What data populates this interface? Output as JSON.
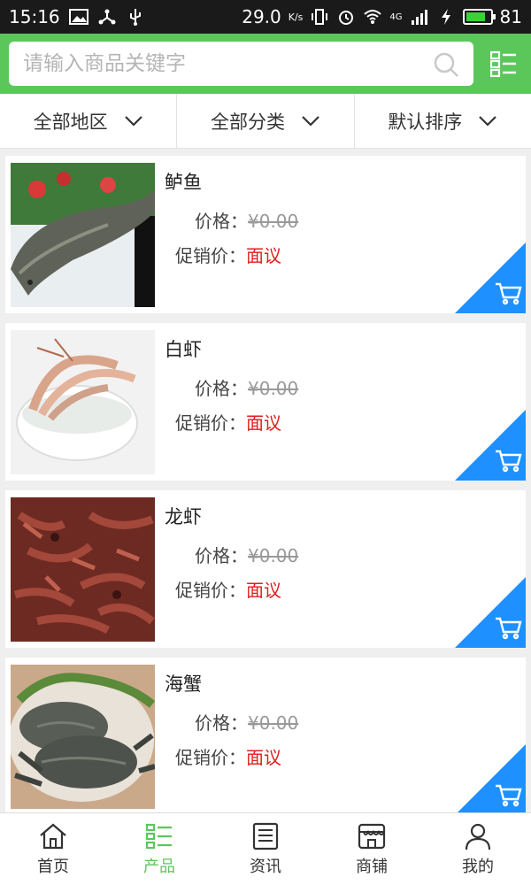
{
  "status_bar": {
    "time": "15:16",
    "speed_value": "29.0",
    "speed_unit": "K/s",
    "network": "4G",
    "battery": "81"
  },
  "search": {
    "placeholder": "请输入商品关键字"
  },
  "filters": [
    {
      "label": "全部地区"
    },
    {
      "label": "全部分类"
    },
    {
      "label": "默认排序"
    }
  ],
  "products": [
    {
      "name": "鲈鱼",
      "price_label": "价格：",
      "price": "¥0.00",
      "promo_label": "促销价：",
      "promo": "面议"
    },
    {
      "name": "白虾",
      "price_label": "价格：",
      "price": "¥0.00",
      "promo_label": "促销价：",
      "promo": "面议"
    },
    {
      "name": "龙虾",
      "price_label": "价格：",
      "price": "¥0.00",
      "promo_label": "促销价：",
      "promo": "面议"
    },
    {
      "name": "海蟹",
      "price_label": "价格：",
      "price": "¥0.00",
      "promo_label": "促销价：",
      "promo": "面议"
    }
  ],
  "nav": [
    {
      "label": "首页",
      "icon": "home-icon"
    },
    {
      "label": "产品",
      "icon": "product-list-icon",
      "active": true
    },
    {
      "label": "资讯",
      "icon": "news-icon"
    },
    {
      "label": "商铺",
      "icon": "shop-icon"
    },
    {
      "label": "我的",
      "icon": "user-icon"
    }
  ],
  "colors": {
    "brand_green": "#5bc75b",
    "cart_blue": "#1e90ff",
    "promo_red": "#e02020"
  }
}
